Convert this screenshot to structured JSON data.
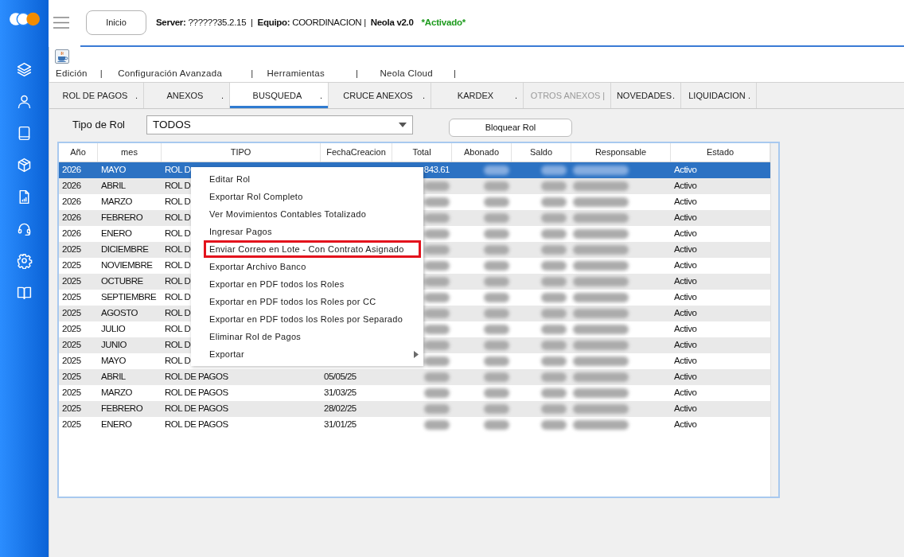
{
  "header": {
    "home_button": "Inicio",
    "status_line": "**Server:** ??????35.2.15  |  **Equipo:** COORDINACION |  **Neola v2.0**",
    "activation": "*Activado*"
  },
  "menu_bar": [
    {
      "label": "Edición",
      "separator": "|"
    },
    {
      "label": "Configuración Avanzada",
      "separator": "|"
    },
    {
      "label": "Herramientas",
      "separator": "|"
    },
    {
      "label": "Neola Cloud",
      "separator": "|"
    }
  ],
  "tabs": [
    {
      "label": "ROL DE PAGOS",
      "mark": ".",
      "selected": false,
      "disabled": false
    },
    {
      "label": "ANEXOS",
      "mark": ".",
      "selected": false,
      "disabled": false
    },
    {
      "label": "BUSQUEDA",
      "mark": ".",
      "selected": true,
      "disabled": false
    },
    {
      "label": "CRUCE ANEXOS",
      "mark": ".",
      "selected": false,
      "disabled": false
    },
    {
      "label": "KARDEX",
      "mark": ".",
      "selected": false,
      "disabled": false
    },
    {
      "label": "OTROS ANEXOS",
      "mark": "|",
      "selected": false,
      "disabled": true
    },
    {
      "label": "NOVEDADES",
      "mark": ".",
      "selected": false,
      "disabled": false
    },
    {
      "label": "LIQUIDACION",
      "mark": ".",
      "selected": false,
      "disabled": false
    }
  ],
  "filter": {
    "label": "Tipo de Rol",
    "value": "TODOS"
  },
  "lock_button": "Bloquear Rol",
  "table": {
    "columns": [
      "Año",
      "mes",
      "TIPO",
      "FechaCreacion",
      "Total",
      "Abonado",
      "Saldo",
      "Responsable",
      "Estado"
    ],
    "rows": [
      {
        "year": "2026",
        "month": "MAYO",
        "type": "ROL D",
        "total": "843.61",
        "status": "Activo",
        "selected": true,
        "blurred": true
      },
      {
        "year": "2026",
        "month": "ABRIL",
        "type": "ROL D",
        "status": "Activo",
        "selected": false,
        "blurred": true
      },
      {
        "year": "2026",
        "month": "MARZO",
        "type": "ROL D",
        "status": "Activo",
        "selected": false,
        "blurred": true
      },
      {
        "year": "2026",
        "month": "FEBRERO",
        "type": "ROL D",
        "status": "Activo",
        "selected": false,
        "blurred": true
      },
      {
        "year": "2026",
        "month": "ENERO",
        "type": "ROL D",
        "status": "Activo",
        "selected": false,
        "blurred": true
      },
      {
        "year": "2025",
        "month": "DICIEMBRE",
        "type": "ROL D",
        "status": "Activo",
        "selected": false,
        "blurred": true
      },
      {
        "year": "2025",
        "month": "NOVIEMBRE",
        "type": "ROL D",
        "status": "Activo",
        "selected": false,
        "blurred": true
      },
      {
        "year": "2025",
        "month": "OCTUBRE",
        "type": "ROL D",
        "status": "Activo",
        "selected": false,
        "blurred": true
      },
      {
        "year": "2025",
        "month": "SEPTIEMBRE",
        "type": "ROL D",
        "status": "Activo",
        "selected": false,
        "blurred": true
      },
      {
        "year": "2025",
        "month": "AGOSTO",
        "type": "ROL D",
        "status": "Activo",
        "selected": false,
        "blurred": true
      },
      {
        "year": "2025",
        "month": "JULIO",
        "type": "ROL D",
        "status": "Activo",
        "selected": false,
        "blurred": true
      },
      {
        "year": "2025",
        "month": "JUNIO",
        "type": "ROL D",
        "status": "Activo",
        "selected": false,
        "blurred": true
      },
      {
        "year": "2025",
        "month": "MAYO",
        "type": "ROL D",
        "status": "Activo",
        "selected": false,
        "blurred": true
      },
      {
        "year": "2025",
        "month": "ABRIL",
        "type": "ROL DE PAGOS",
        "date": "05/05/25",
        "status": "Activo",
        "selected": false,
        "blurred": true
      },
      {
        "year": "2025",
        "month": "MARZO",
        "type": "ROL DE PAGOS",
        "date": "31/03/25",
        "status": "Activo",
        "selected": false,
        "blurred": true
      },
      {
        "year": "2025",
        "month": "FEBRERO",
        "type": "ROL DE PAGOS",
        "date": "28/02/25",
        "status": "Activo",
        "selected": false,
        "blurred": true
      },
      {
        "year": "2025",
        "month": "ENERO",
        "type": "ROL DE PAGOS",
        "date": "31/01/25",
        "status": "Activo",
        "selected": false,
        "blurred": true
      }
    ]
  },
  "context_menu": {
    "items": [
      {
        "label": "Editar Rol",
        "outlined": false,
        "submenu": false
      },
      {
        "label": "Exportar Rol Completo",
        "outlined": false,
        "submenu": false
      },
      {
        "label": "Ver Movimientos Contables Totalizado",
        "outlined": false,
        "submenu": false
      },
      {
        "label": "Ingresar Pagos",
        "outlined": false,
        "submenu": false
      },
      {
        "label": "Enviar Correo en Lote - Con Contrato Asignado",
        "outlined": true,
        "submenu": false
      },
      {
        "label": "Exportar Archivo Banco",
        "outlined": false,
        "submenu": false
      },
      {
        "label": "Exportar en PDF todos los Roles",
        "outlined": false,
        "submenu": false
      },
      {
        "label": "Exportar en PDF todos los Roles por CC",
        "outlined": false,
        "submenu": false
      },
      {
        "label": "Exportar en PDF todos los Roles por Separado",
        "outlined": false,
        "submenu": false
      },
      {
        "label": "Eliminar Rol de Pagos",
        "outlined": false,
        "submenu": false
      },
      {
        "label": "Exportar",
        "outlined": false,
        "submenu": true
      }
    ]
  }
}
